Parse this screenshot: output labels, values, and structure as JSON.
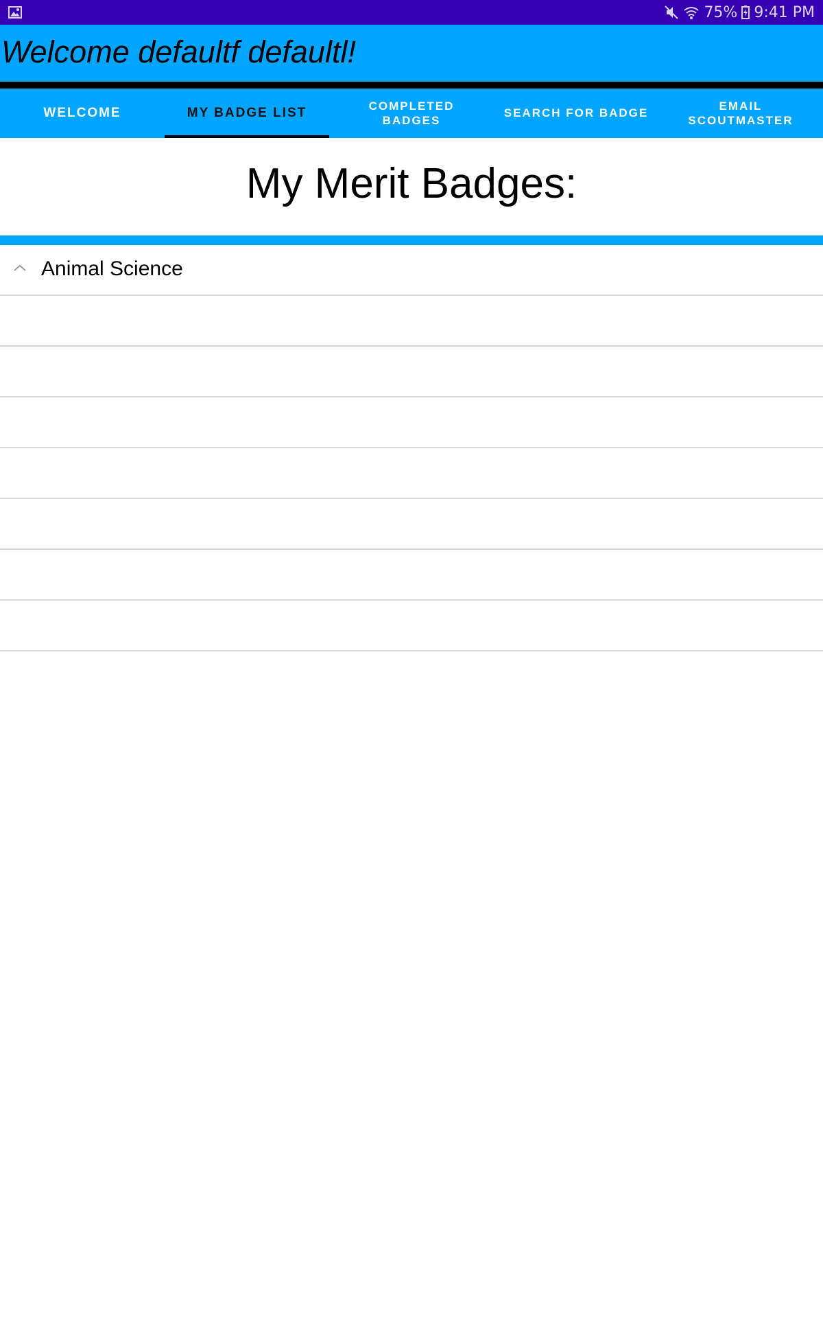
{
  "status_bar": {
    "left_icon": "image-icon",
    "battery": "75%",
    "time": "9:41 PM",
    "icons": [
      "mute-icon",
      "wifi-icon",
      "battery-icon"
    ]
  },
  "header": {
    "title": "Welcome defaultf defaultl!"
  },
  "tabs": [
    {
      "lines": [
        "WELCOME"
      ],
      "active": false
    },
    {
      "lines": [
        "MY BADGE LIST"
      ],
      "active": true
    },
    {
      "lines": [
        "COMPLETED",
        "BADGES"
      ],
      "active": false
    },
    {
      "lines": [
        "SEARCH FOR BADGE"
      ],
      "active": false
    },
    {
      "lines": [
        "EMAIL",
        "SCOUTMASTER"
      ],
      "active": false
    }
  ],
  "main": {
    "heading": "My Merit Badges:",
    "items": [
      {
        "label": "Animal Science",
        "expanded": true
      },
      {
        "label": ""
      },
      {
        "label": ""
      },
      {
        "label": ""
      },
      {
        "label": ""
      },
      {
        "label": ""
      },
      {
        "label": ""
      },
      {
        "label": ""
      }
    ]
  },
  "colors": {
    "status_bar": "#3700b3",
    "primary": "#00a5ff",
    "tab_indicator": "#000000"
  }
}
